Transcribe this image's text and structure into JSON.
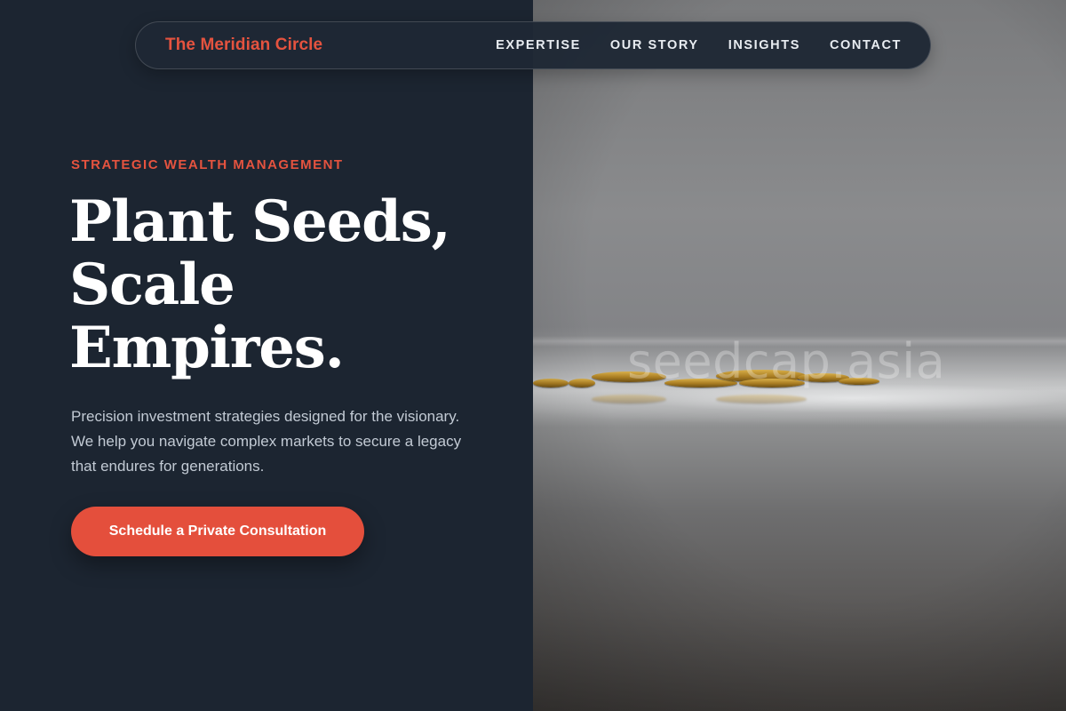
{
  "nav": {
    "brand": "The Meridian Circle",
    "links": [
      "EXPERTISE",
      "OUR STORY",
      "INSIGHTS",
      "CONTACT"
    ]
  },
  "hero": {
    "eyebrow": "STRATEGIC WEALTH MANAGEMENT",
    "headline_lines": [
      "Plant Seeds,",
      "Scale",
      "Empires."
    ],
    "description": "Precision investment strategies designed for the visionary. We help you navigate complex markets to secure a legacy that endures for generations.",
    "cta_label": "Schedule a Private Consultation"
  },
  "image": {
    "watermark": "seedcap.asia"
  },
  "colors": {
    "accent": "#e5533f",
    "background": "#1c2531",
    "cta": "#e44f3c"
  }
}
